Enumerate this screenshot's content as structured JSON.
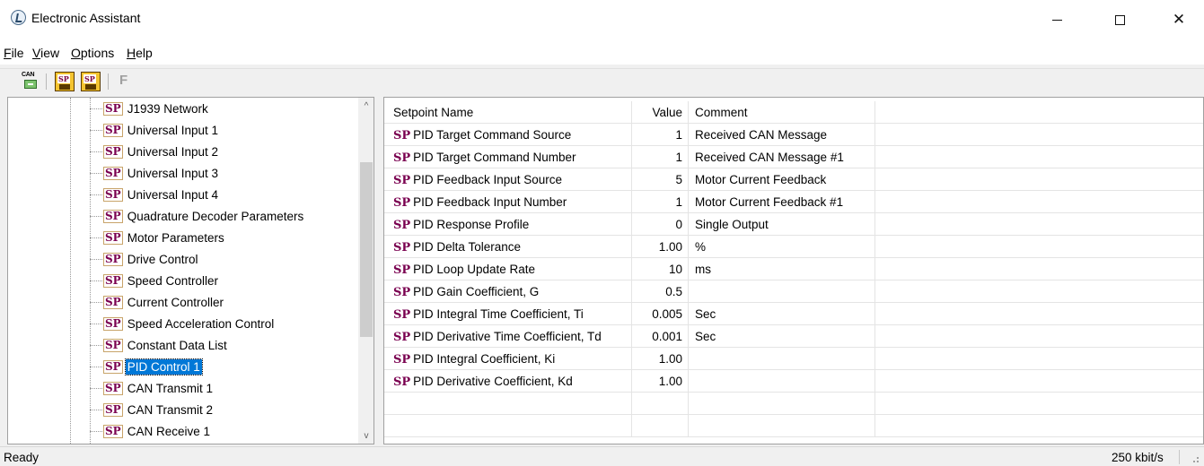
{
  "window": {
    "title": "Electronic Assistant",
    "minimize_glyph": "—",
    "close_glyph": "✕"
  },
  "menu": [
    {
      "underline": "F",
      "rest": "ile"
    },
    {
      "underline": "V",
      "rest": "iew"
    },
    {
      "underline": "O",
      "rest": "ptions"
    },
    {
      "underline": "H",
      "rest": "elp"
    }
  ],
  "toolbar": {
    "can_label": "CAN",
    "disk_label": "SP",
    "f_label": "F"
  },
  "tree": {
    "icon_text": "SP",
    "items": [
      {
        "label": "J1939 Network"
      },
      {
        "label": "Universal Input 1"
      },
      {
        "label": "Universal Input 2"
      },
      {
        "label": "Universal Input 3"
      },
      {
        "label": "Universal Input 4"
      },
      {
        "label": "Quadrature Decoder Parameters"
      },
      {
        "label": "Motor Parameters"
      },
      {
        "label": "Drive Control"
      },
      {
        "label": "Speed Controller"
      },
      {
        "label": "Current Controller"
      },
      {
        "label": "Speed Acceleration Control"
      },
      {
        "label": "Constant Data List"
      },
      {
        "label": "PID Control 1",
        "selected": true
      },
      {
        "label": "CAN Transmit 1"
      },
      {
        "label": "CAN Transmit 2"
      },
      {
        "label": "CAN Receive 1"
      }
    ],
    "scroll_up": "^",
    "scroll_down": "v"
  },
  "grid": {
    "headers": {
      "name": "Setpoint Name",
      "value": "Value",
      "comment": "Comment"
    },
    "icon_text": "SP",
    "rows": [
      {
        "name": "PID Target Command Source",
        "value": "1",
        "comment": "Received CAN Message"
      },
      {
        "name": "PID Target Command Number",
        "value": "1",
        "comment": "Received CAN Message #1"
      },
      {
        "name": "PID Feedback Input Source",
        "value": "5",
        "comment": "Motor Current Feedback"
      },
      {
        "name": "PID Feedback Input Number",
        "value": "1",
        "comment": "Motor Current Feedback #1"
      },
      {
        "name": "PID Response Profile",
        "value": "0",
        "comment": "Single Output"
      },
      {
        "name": "PID Delta Tolerance",
        "value": "1.00",
        "comment": "%"
      },
      {
        "name": "PID Loop Update Rate",
        "value": "10",
        "comment": "ms"
      },
      {
        "name": "PID Gain Coefficient, G",
        "value": "0.5",
        "comment": ""
      },
      {
        "name": "PID Integral Time Coefficient, Ti",
        "value": "0.005",
        "comment": "Sec"
      },
      {
        "name": "PID Derivative Time Coefficient, Td",
        "value": "0.001",
        "comment": "Sec"
      },
      {
        "name": "PID Integral Coefficient, Ki",
        "value": "1.00",
        "comment": ""
      },
      {
        "name": "PID Derivative Coefficient, Kd",
        "value": "1.00",
        "comment": ""
      }
    ]
  },
  "status": {
    "text": "Ready",
    "baud": "250 kbit/s"
  }
}
